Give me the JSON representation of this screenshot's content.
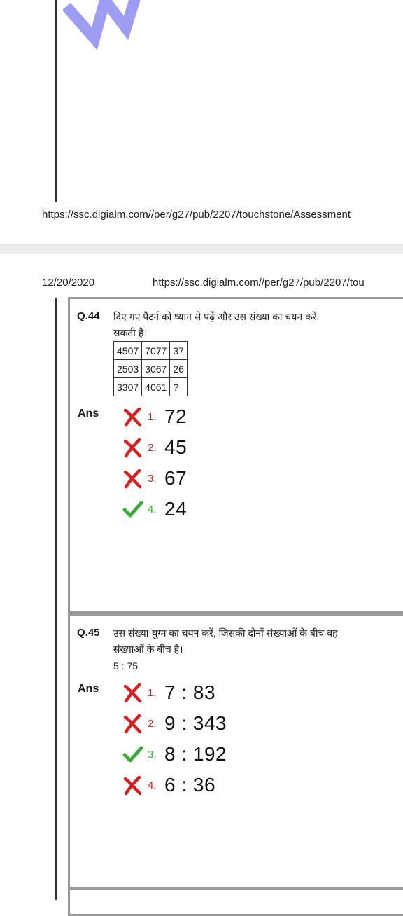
{
  "top_page": {
    "watermark_text": "M",
    "footer_url": "https://ssc.digialm.com//per/g27/pub/2207/touchstone/Assessment"
  },
  "header": {
    "date": "12/20/2020",
    "url": "https://ssc.digialm.com//per/g27/pub/2207/tou"
  },
  "questions": [
    {
      "number": "Q.44",
      "text_line1": "दिए गए पैटर्न को ध्यान से पढ़ें और उस संख्या का चयन करें,",
      "text_line2": "सकती है।",
      "table": [
        [
          "4507",
          "7077",
          "37"
        ],
        [
          "2503",
          "3067",
          "26"
        ],
        [
          "3307",
          "4061",
          "?"
        ]
      ],
      "ans_label": "Ans",
      "options": [
        {
          "num": "1.",
          "value": "72",
          "status": "wrong"
        },
        {
          "num": "2.",
          "value": "45",
          "status": "wrong"
        },
        {
          "num": "3.",
          "value": "67",
          "status": "wrong"
        },
        {
          "num": "4.",
          "value": "24",
          "status": "correct"
        }
      ]
    },
    {
      "number": "Q.45",
      "text_line1": "उस संख्या-युग्म का चयन करें, जिसकी दोनों संख्याओं के बीच वह",
      "text_line2": "संख्याओं के बीच है।",
      "pair": "5 : 75",
      "ans_label": "Ans",
      "options": [
        {
          "num": "1.",
          "value": "7 : 83",
          "status": "wrong"
        },
        {
          "num": "2.",
          "value": "9 : 343",
          "status": "wrong"
        },
        {
          "num": "3.",
          "value": "8 : 192",
          "status": "correct"
        },
        {
          "num": "4.",
          "value": "6 : 36",
          "status": "wrong"
        }
      ]
    }
  ],
  "colors": {
    "wrong": "#d42020",
    "correct": "#3aa83a",
    "watermark": "#8c8cf0"
  }
}
